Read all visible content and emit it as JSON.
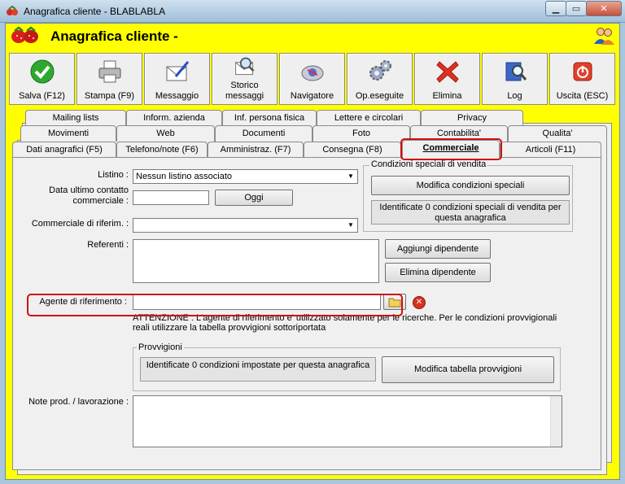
{
  "window": {
    "title": "Anagrafica cliente - BLABLABLA",
    "header_title": "Anagrafica cliente -",
    "min_glyph": "▁",
    "max_glyph": "▭",
    "close_glyph": "✕"
  },
  "toolbar": {
    "buttons": [
      {
        "label": "Salva (F12)",
        "icon": "checkmark-icon"
      },
      {
        "label": "Stampa (F9)",
        "icon": "printer-icon"
      },
      {
        "label": "Messaggio",
        "icon": "envelope-pen-icon"
      },
      {
        "label": "Storico messaggi",
        "icon": "envelope-search-icon"
      },
      {
        "label": "Navigatore",
        "icon": "compass-icon"
      },
      {
        "label": "Op.eseguite",
        "icon": "gears-icon"
      },
      {
        "label": "Elimina",
        "icon": "red-x-icon"
      },
      {
        "label": "Log",
        "icon": "book-search-icon"
      },
      {
        "label": "Uscita (ESC)",
        "icon": "power-icon"
      }
    ]
  },
  "tabs": {
    "row1": [
      "Mailing lists",
      "Inform. azienda",
      "Inf. persona fisica",
      "Lettere e circolari",
      "Privacy"
    ],
    "row2": [
      "Movimenti",
      "Web",
      "Documenti",
      "Foto",
      "Contabilita'",
      "Qualita'"
    ],
    "row3": [
      "Dati anagrafici (F5)",
      "Telefono/note (F6)",
      "Amministraz. (F7)",
      "Consegna (F8)",
      "Commerciale",
      "Articoli (F11)"
    ]
  },
  "form": {
    "listino_label": "Listino :",
    "listino_value": "Nessun listino associato",
    "data_contatto_label": "Data ultimo contatto commerciale :",
    "oggi_button": "Oggi",
    "commerciale_label": "Commerciale di riferim. :",
    "referenti_label": "Referenti :",
    "aggiungi_button": "Aggiungi dipendente",
    "elimina_button": "Elimina dipendente",
    "agente_label": "Agente di riferimento :",
    "attenzione_text": "ATTENZIONE : L'agente di riferimento e' utilizzato solamente per le ricerche. Per le condizioni provvigionali reali utilizzare la tabella provvigioni sottoriportata",
    "note_label": "Note prod. / lavorazione :"
  },
  "condizioni": {
    "group_title": "Condizioni speciali di vendita",
    "modifica_button": "Modifica condizioni speciali",
    "info": "Identificate 0 condizioni speciali di vendita per questa anagrafica"
  },
  "provvigioni": {
    "group_title": "Provvigioni",
    "info": "Identificate 0 condizioni impostate per questa anagrafica",
    "modifica_button": "Modifica tabella provvigioni"
  },
  "colors": {
    "background_yellow": "#ffff00",
    "highlight_red": "#cc1010"
  }
}
